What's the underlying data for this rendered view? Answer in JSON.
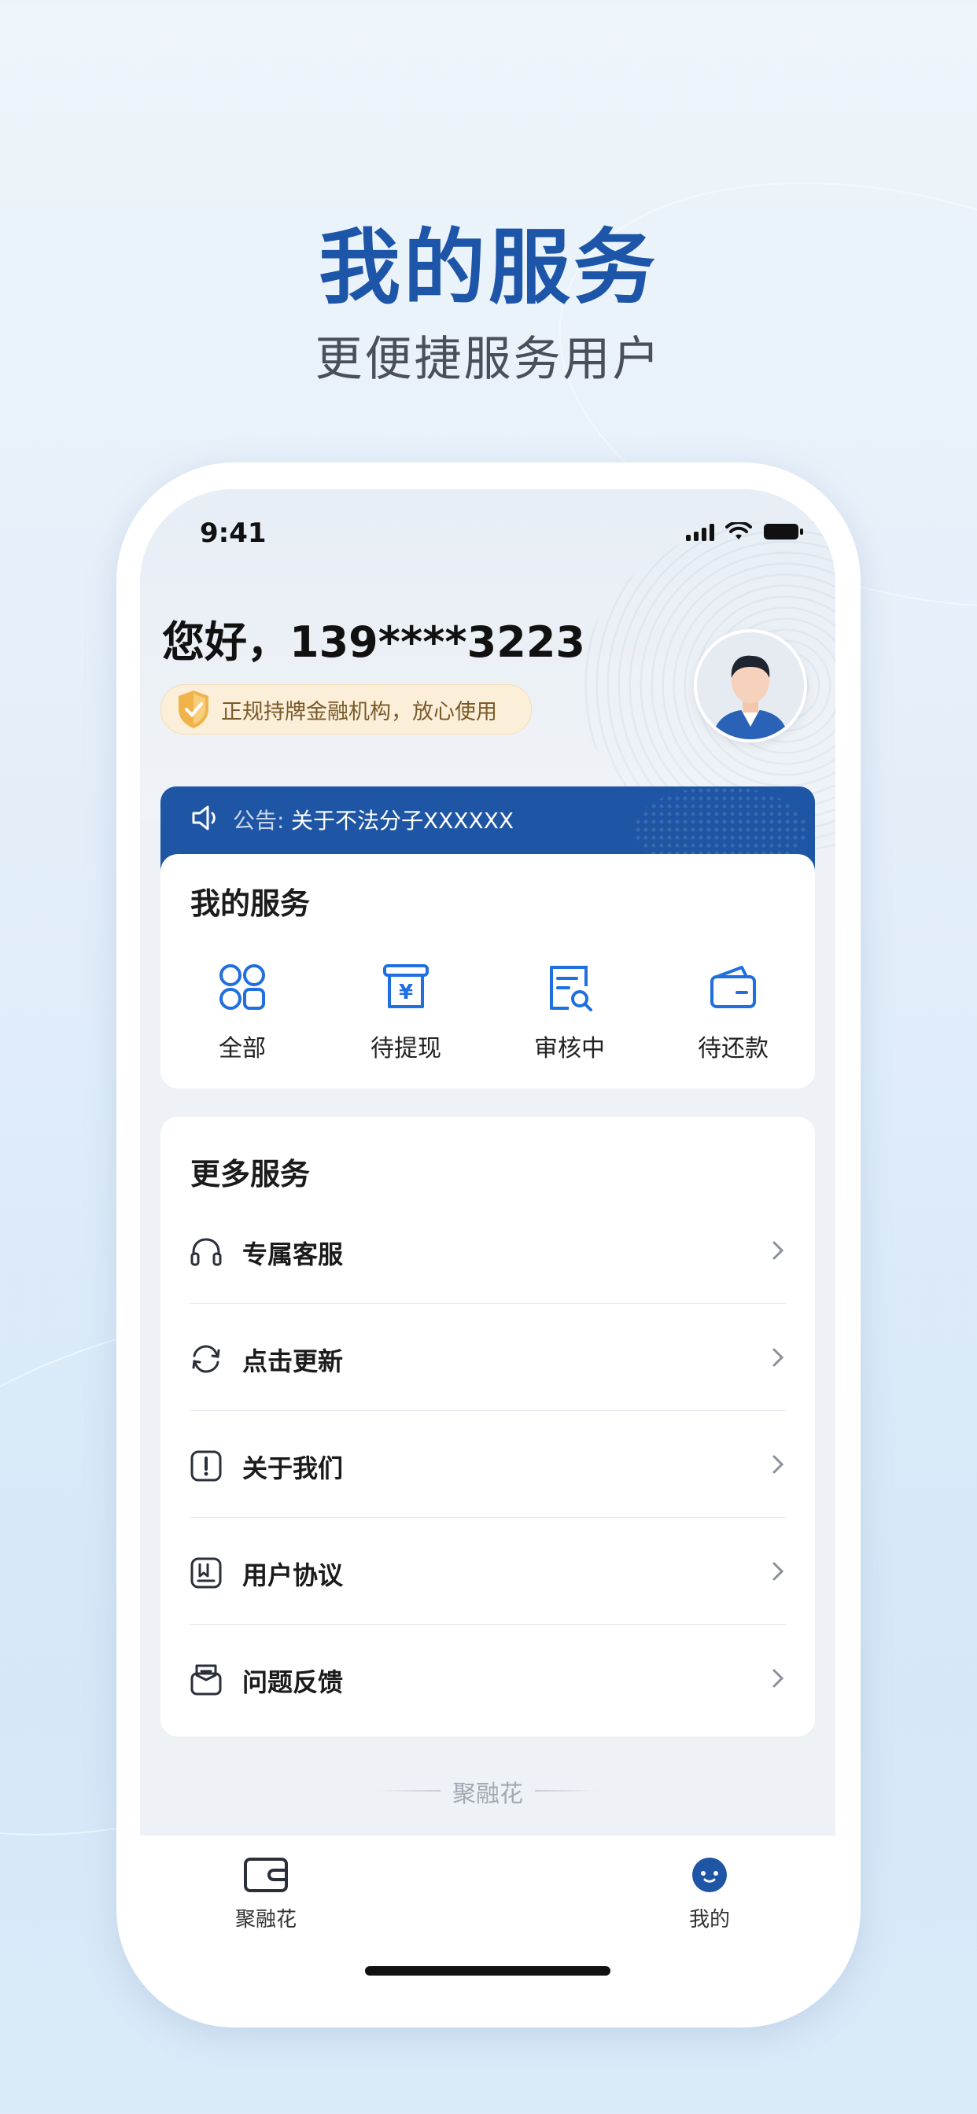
{
  "promo": {
    "headline": "我的服务",
    "subline": "更便捷服务用户"
  },
  "status_bar": {
    "time": "9:41"
  },
  "user": {
    "greeting": "您好，139****3223",
    "trust_badge": "正规持牌金融机构，放心使用"
  },
  "notice": {
    "label": "公告:",
    "text": "关于不法分子XXXXXX"
  },
  "my_services": {
    "title": "我的服务",
    "items": [
      {
        "label": "全部",
        "icon": "grid-icon"
      },
      {
        "label": "待提现",
        "icon": "withdraw-icon"
      },
      {
        "label": "审核中",
        "icon": "review-icon"
      },
      {
        "label": "待还款",
        "icon": "wallet-icon"
      }
    ]
  },
  "more_services": {
    "title": "更多服务",
    "items": [
      {
        "label": "专属客服",
        "icon": "headset-icon"
      },
      {
        "label": "点击更新",
        "icon": "refresh-icon"
      },
      {
        "label": "关于我们",
        "icon": "info-icon"
      },
      {
        "label": "用户协议",
        "icon": "agreement-icon"
      },
      {
        "label": "问题反馈",
        "icon": "feedback-icon"
      }
    ]
  },
  "footer_brand": "聚融花",
  "tabbar": {
    "tabs": [
      {
        "label": "聚融花",
        "icon": "wallet-tab-icon",
        "active": false
      },
      {
        "label": "我的",
        "icon": "profile-tab-icon",
        "active": true
      }
    ]
  },
  "colors": {
    "brand_blue": "#1e55a4",
    "accent_blue": "#1f6fe0",
    "text": "#1b1b1b"
  }
}
